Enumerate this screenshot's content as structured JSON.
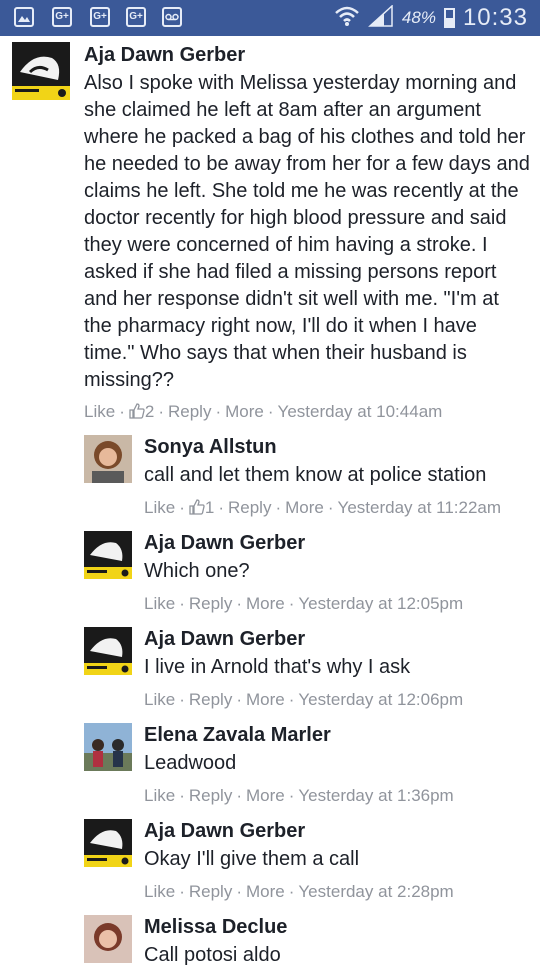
{
  "status_bar": {
    "battery_text": "48%",
    "battery_level": 0.48,
    "time": "10:33",
    "icons": [
      "gallery-icon",
      "google-plus-icon",
      "google-plus-icon",
      "google-plus-icon",
      "voicemail-icon",
      "wifi-icon",
      "signal-icon"
    ]
  },
  "comments": [
    {
      "name": "Aja Dawn Gerber",
      "text": "Also I spoke with Melissa yesterday morning and she claimed he left at 8am after an argument where he packed a bag of his clothes and told her he needed to be away from her for a few days and claims he left. She told me he was recently at the doctor recently for high blood pressure and said they were concerned of him having a stroke. I asked if she had filed a missing persons report and her response didn't sit well with me. \"I'm at the pharmacy right now, I'll do it when I have time.\" Who says that when their husband is missing??",
      "like": "Like",
      "likes": "2",
      "reply": "Reply",
      "more": "More",
      "time": "Yesterday at 10:44am"
    },
    {
      "name": "Sonya Allstun",
      "text": "call and let them know at police station",
      "like": "Like",
      "likes": "1",
      "reply": "Reply",
      "more": "More",
      "time": "Yesterday at 11:22am"
    },
    {
      "name": "Aja Dawn Gerber",
      "text": "Which one?",
      "like": "Like",
      "reply": "Reply",
      "more": "More",
      "time": "Yesterday at 12:05pm"
    },
    {
      "name": "Aja Dawn Gerber",
      "text": "I live in Arnold that's why I ask",
      "like": "Like",
      "reply": "Reply",
      "more": "More",
      "time": "Yesterday at 12:06pm"
    },
    {
      "name": "Elena Zavala Marler",
      "text": "Leadwood",
      "like": "Like",
      "reply": "Reply",
      "more": "More",
      "time": "Yesterday at 1:36pm"
    },
    {
      "name": "Aja Dawn Gerber",
      "text": "Okay I'll give them a call",
      "like": "Like",
      "reply": "Reply",
      "more": "More",
      "time": "Yesterday at 2:28pm"
    },
    {
      "name": "Melissa Declue",
      "text": "Call potosi aldo"
    }
  ]
}
